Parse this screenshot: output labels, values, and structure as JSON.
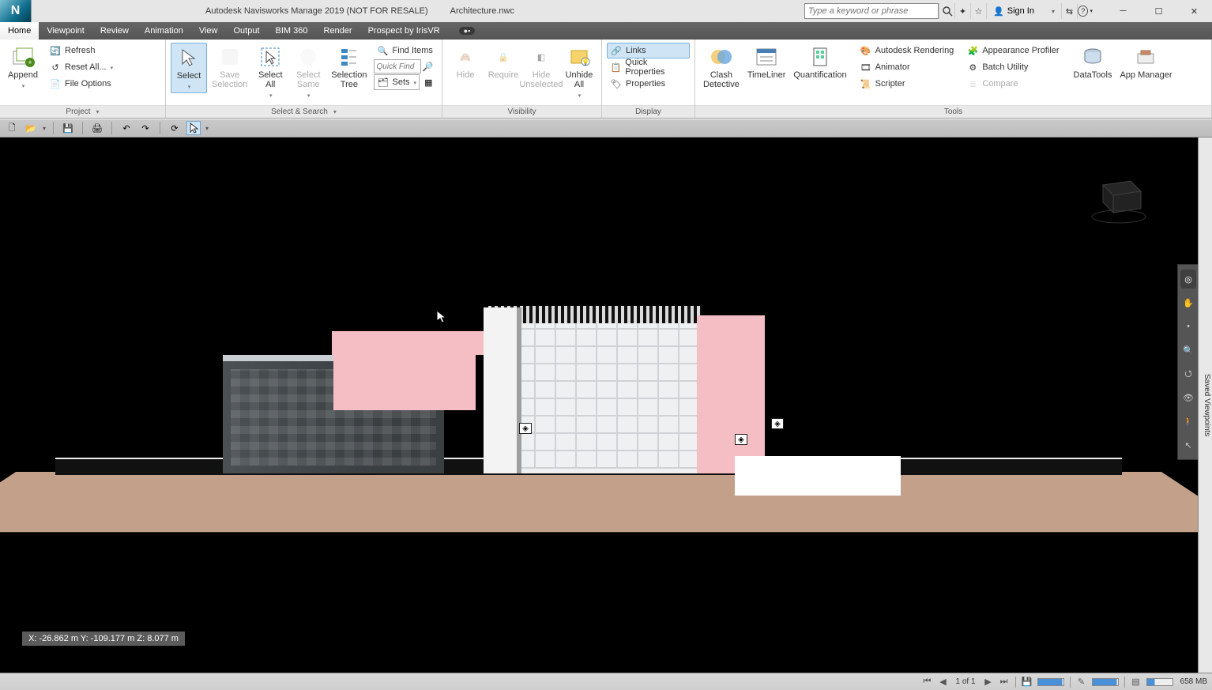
{
  "title": {
    "app": "Autodesk Navisworks Manage 2019 (NOT FOR RESALE)",
    "file": "Architecture.nwc"
  },
  "infocenter": {
    "search_placeholder": "Type a keyword or phrase",
    "signin": "Sign In"
  },
  "tabs": [
    "Home",
    "Viewpoint",
    "Review",
    "Animation",
    "View",
    "Output",
    "BIM 360",
    "Render",
    "Prospect by IrisVR"
  ],
  "active_tab": 0,
  "ribbon": {
    "project": {
      "append": "Append",
      "refresh": "Refresh",
      "reset_all": "Reset All...",
      "file_options": "File Options",
      "panel": "Project"
    },
    "selsearch": {
      "select": "Select",
      "save_selection": "Save\nSelection",
      "select_all": "Select\nAll",
      "select_same": "Select\nSame",
      "selection_tree": "Selection\nTree",
      "find_items": "Find Items",
      "quick_find": "Quick Find",
      "sets": "Sets",
      "panel": "Select & Search"
    },
    "visibility": {
      "hide": "Hide",
      "require": "Require",
      "hide_unselected": "Hide\nUnselected",
      "unhide_all": "Unhide\nAll",
      "panel": "Visibility"
    },
    "display": {
      "links": "Links",
      "quick_properties": "Quick Properties",
      "properties": "Properties",
      "panel": "Display"
    },
    "tools": {
      "clash": "Clash\nDetective",
      "timeliner": "TimeLiner",
      "quantification": "Quantification",
      "rendering": "Autodesk Rendering",
      "animator": "Animator",
      "scripter": "Scripter",
      "appearance": "Appearance Profiler",
      "batch": "Batch Utility",
      "compare": "Compare",
      "datatools": "DataTools",
      "appmanager": "App Manager",
      "panel": "Tools"
    }
  },
  "side_panel": "Saved Viewpoints",
  "coords": "X: -26.862 m  Y: -109.177 m  Z: 8.077 m",
  "status": {
    "sheet": "1 of 1",
    "mem": "658 MB"
  }
}
